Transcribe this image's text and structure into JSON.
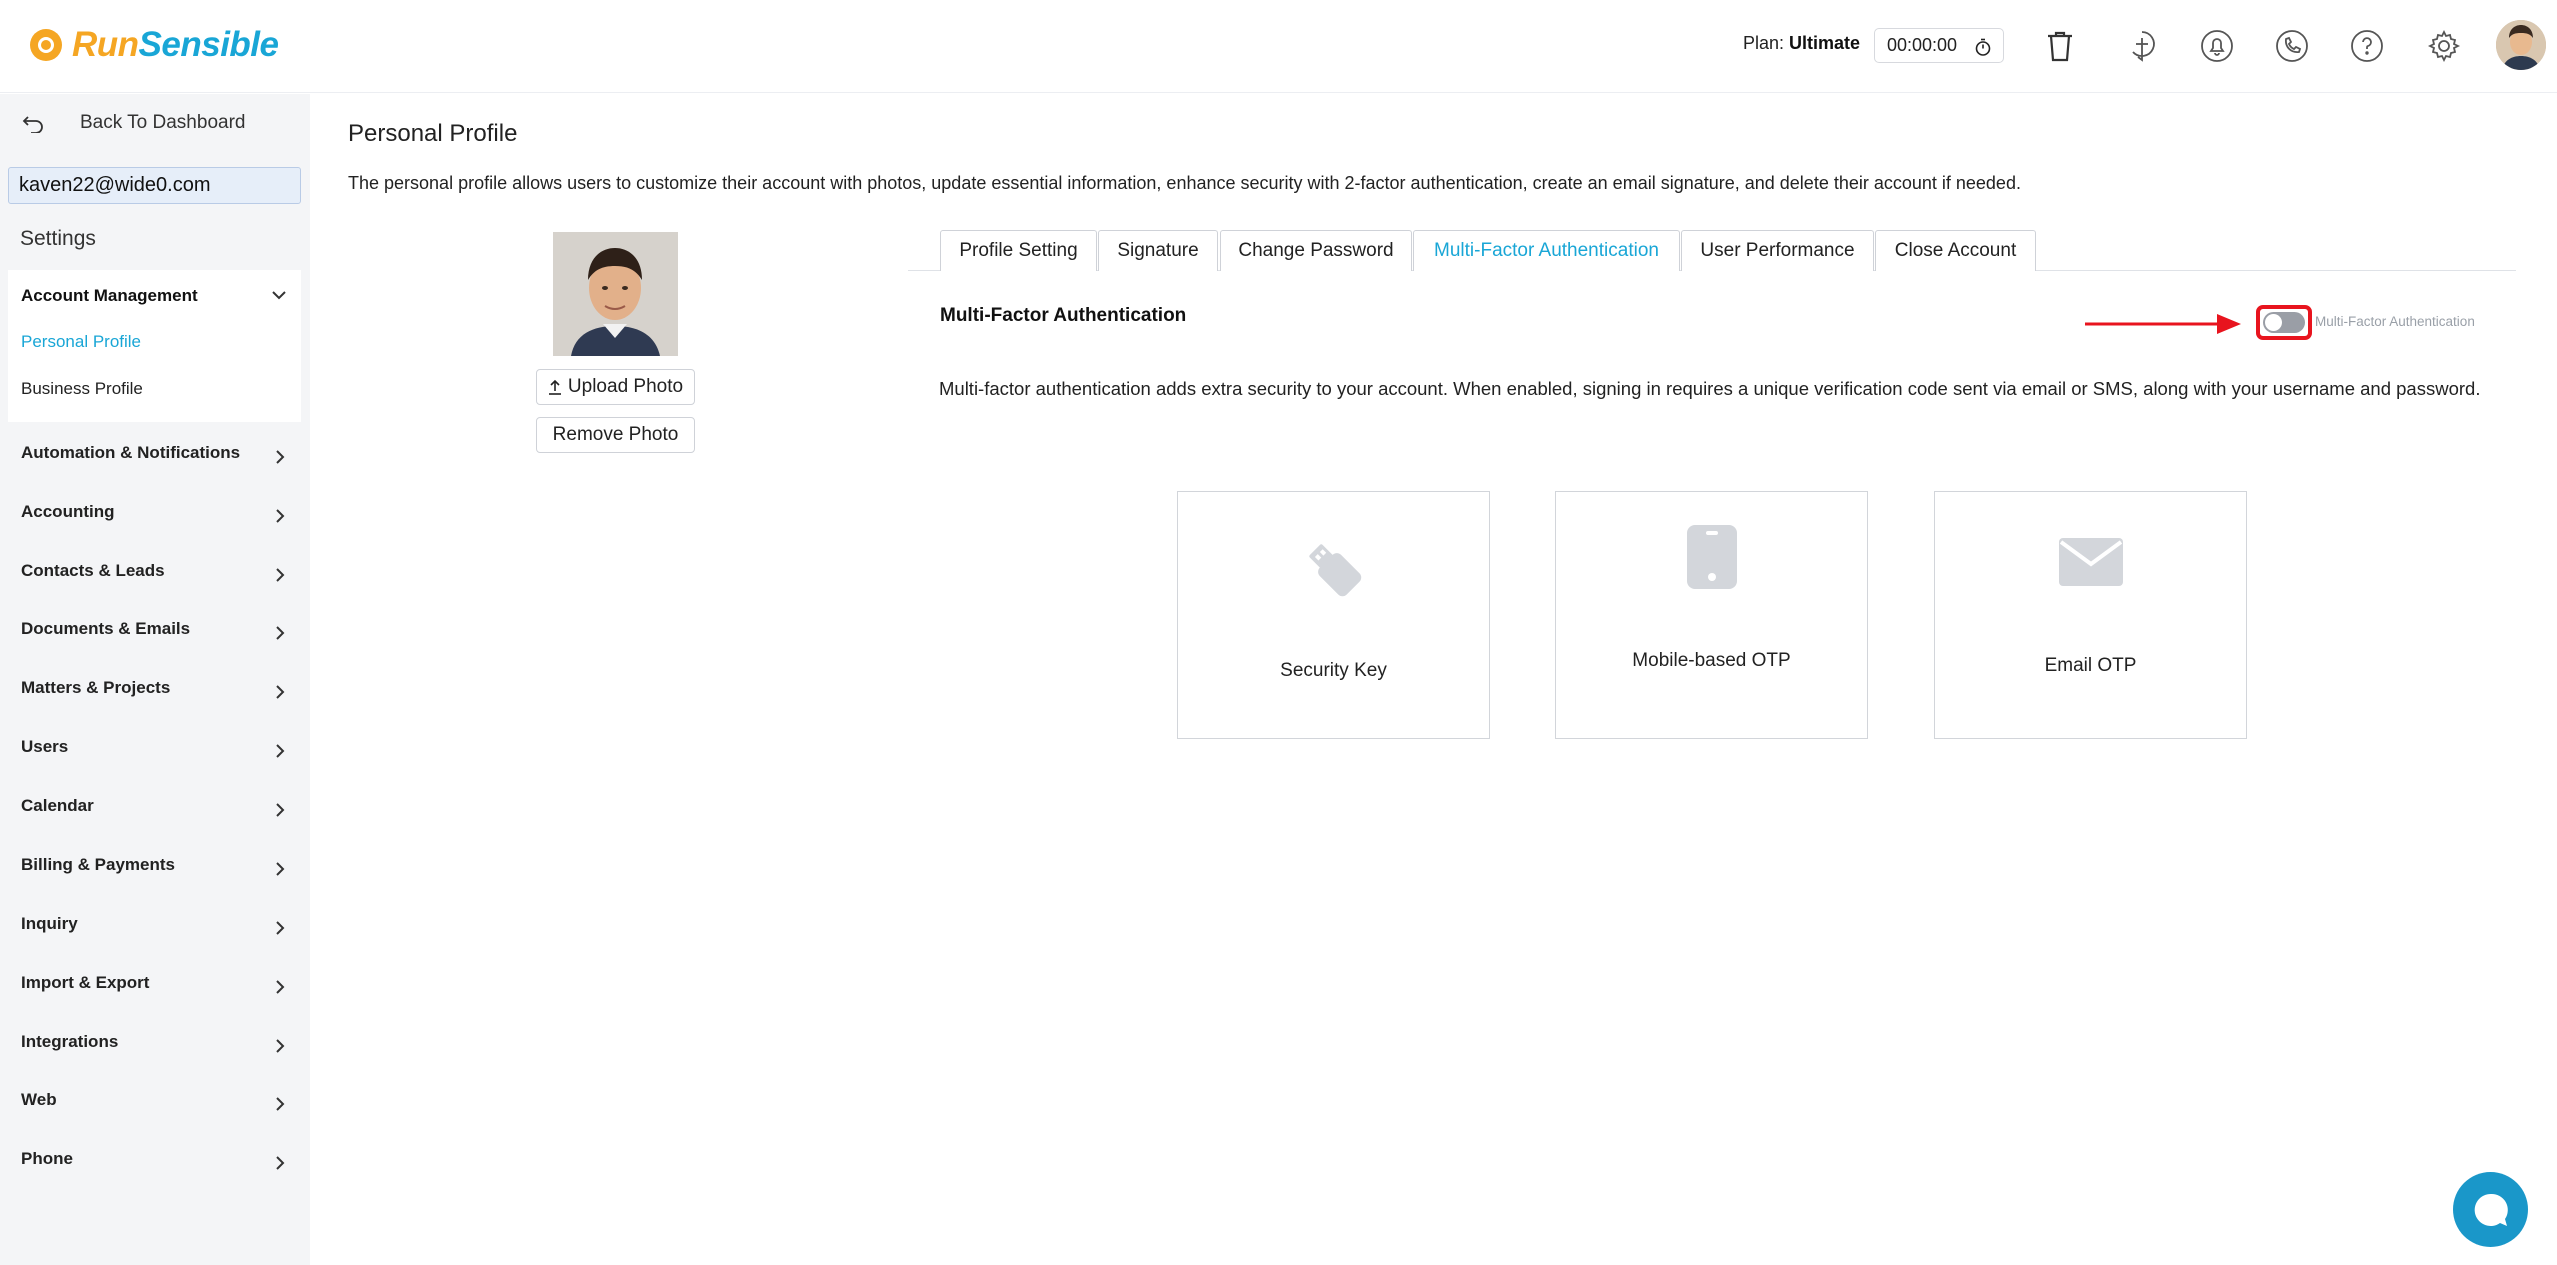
{
  "brand": {
    "name_part1": "Run",
    "name_part2": "Sensible",
    "accent": "#19a6d6",
    "orange": "#f5a623"
  },
  "header": {
    "plan_label": "Plan:",
    "plan_value": "Ultimate",
    "timer": "00:00:00",
    "icons": [
      "trash-icon",
      "add-task-icon",
      "notification-bell-icon",
      "phone-icon",
      "help-icon",
      "settings-gear-icon",
      "user-avatar"
    ]
  },
  "sidebar": {
    "back_label": "Back To Dashboard",
    "user_email": "kaven22@wide0.com",
    "settings_title": "Settings",
    "account_management": {
      "label": "Account Management",
      "items": [
        {
          "label": "Personal Profile",
          "active": true
        },
        {
          "label": "Business Profile",
          "active": false
        }
      ]
    },
    "nav": [
      {
        "label": "Automation & Notifications"
      },
      {
        "label": "Accounting"
      },
      {
        "label": "Contacts & Leads"
      },
      {
        "label": "Documents & Emails"
      },
      {
        "label": "Matters & Projects"
      },
      {
        "label": "Users"
      },
      {
        "label": "Calendar"
      },
      {
        "label": "Billing & Payments"
      },
      {
        "label": "Inquiry"
      },
      {
        "label": "Import & Export"
      },
      {
        "label": "Integrations"
      },
      {
        "label": "Web"
      },
      {
        "label": "Phone"
      }
    ]
  },
  "main": {
    "title": "Personal Profile",
    "description": "The personal profile allows users to customize their account with photos, update essential information, enhance security with 2-factor authentication, create an email signature, and delete their account if needed.",
    "upload_photo": "Upload Photo",
    "remove_photo": "Remove Photo",
    "tabs": [
      {
        "label": "Profile Setting",
        "active": false
      },
      {
        "label": "Signature",
        "active": false
      },
      {
        "label": "Change Password",
        "active": false
      },
      {
        "label": "Multi-Factor Authentication",
        "active": true
      },
      {
        "label": "User Performance",
        "active": false
      },
      {
        "label": "Close Account",
        "active": false
      }
    ],
    "mfa": {
      "title": "Multi-Factor Authentication",
      "toggle_label": "Multi-Factor Authentication",
      "toggle_on": false,
      "description": "Multi-factor authentication adds extra security to your account. When enabled, signing in requires a unique verification code sent via email or SMS, along with your username and password.",
      "options": [
        {
          "label": "Security Key",
          "icon": "usb-key-icon"
        },
        {
          "label": "Mobile-based OTP",
          "icon": "mobile-phone-icon"
        },
        {
          "label": "Email OTP",
          "icon": "envelope-icon"
        }
      ]
    }
  }
}
